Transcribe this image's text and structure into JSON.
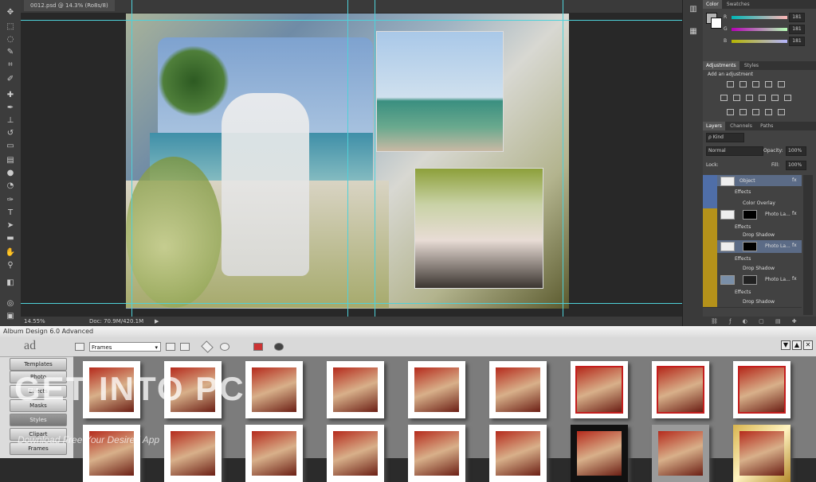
{
  "document": {
    "tab_label": "0012.psd @ 14.3% (Ro8s/8)",
    "zoom": "14.55%",
    "doc_size": "Doc: 70.9M/420.1M"
  },
  "color_panel": {
    "tabs": [
      "Color",
      "Swatches"
    ],
    "channels": [
      {
        "label": "R",
        "value": "181"
      },
      {
        "label": "G",
        "value": "181"
      },
      {
        "label": "B",
        "value": "181"
      }
    ]
  },
  "adjustments_panel": {
    "tabs": [
      "Adjustments",
      "Styles"
    ],
    "heading": "Add an adjustment"
  },
  "layers_panel": {
    "tabs": [
      "Layers",
      "Channels",
      "Paths"
    ],
    "kind": "ρ Kind",
    "blend_mode": "Normal",
    "opacity_label": "Opacity:",
    "opacity_value": "100%",
    "lock_label": "Lock:",
    "fill_label": "Fill:",
    "fill_value": "100%",
    "layers": [
      {
        "name": "Object",
        "fx": "fx"
      },
      {
        "name": "Effects",
        "fx": ""
      },
      {
        "name": "Color Overlay",
        "fx": ""
      },
      {
        "name": "Photo La...",
        "fx": "fx"
      },
      {
        "name": "Effects",
        "fx": ""
      },
      {
        "name": "Drop Shadow",
        "fx": ""
      },
      {
        "name": "Photo La...",
        "fx": "fx"
      },
      {
        "name": "Effects",
        "fx": ""
      },
      {
        "name": "Drop Shadow",
        "fx": ""
      },
      {
        "name": "Photo La...",
        "fx": "fx"
      },
      {
        "name": "Effects",
        "fx": ""
      },
      {
        "name": "Drop Shadow",
        "fx": ""
      }
    ]
  },
  "plugin": {
    "title": "Album Design 6.0 Advanced",
    "logo": "ad",
    "category_select": "Frames",
    "sidebar": [
      "Templates",
      "Photo",
      "Effects",
      "Masks",
      "Styles",
      "Clipart",
      "Frames"
    ],
    "window_buttons": [
      "▼",
      "▲",
      "✕"
    ]
  },
  "watermark": {
    "main": "GET INTO PC",
    "sub": "Download Free Your Desired App"
  }
}
